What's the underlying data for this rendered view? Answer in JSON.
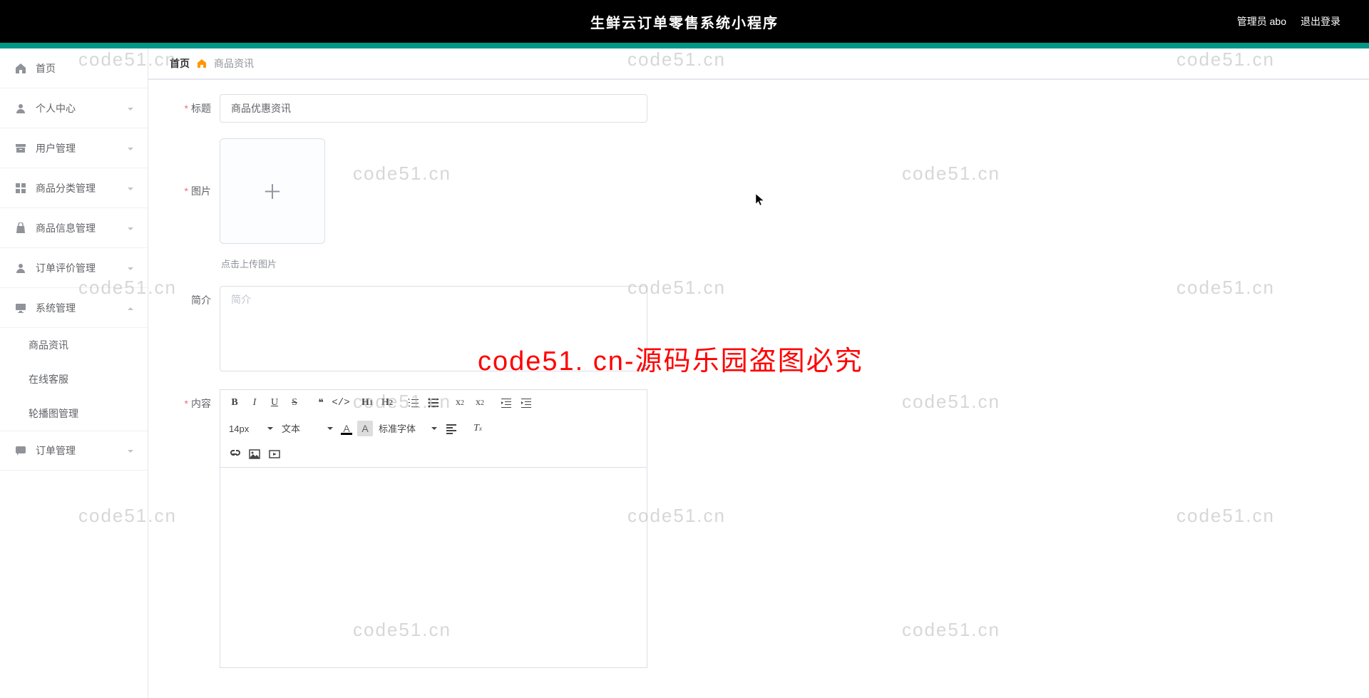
{
  "header": {
    "title": "生鲜云订单零售系统小程序",
    "admin_label": "管理员 abo",
    "logout_label": "退出登录"
  },
  "sidebar": {
    "items": [
      {
        "key": "home",
        "label": "首页",
        "icon": "home",
        "has_children": false
      },
      {
        "key": "personal",
        "label": "个人中心",
        "icon": "user",
        "has_children": true
      },
      {
        "key": "users",
        "label": "用户管理",
        "icon": "archive",
        "has_children": true
      },
      {
        "key": "category",
        "label": "商品分类管理",
        "icon": "grid",
        "has_children": true
      },
      {
        "key": "product",
        "label": "商品信息管理",
        "icon": "bag",
        "has_children": true
      },
      {
        "key": "review",
        "label": "订单评价管理",
        "icon": "person",
        "has_children": true
      },
      {
        "key": "system",
        "label": "系统管理",
        "icon": "monitor",
        "has_children": true,
        "expanded": true,
        "children": [
          {
            "key": "news",
            "label": "商品资讯"
          },
          {
            "key": "service",
            "label": "在线客服"
          },
          {
            "key": "carousel",
            "label": "轮播图管理"
          }
        ]
      },
      {
        "key": "order",
        "label": "订单管理",
        "icon": "chat",
        "has_children": true
      }
    ]
  },
  "breadcrumb": {
    "home": "首页",
    "current": "商品资讯"
  },
  "form": {
    "title_label": "标题",
    "title_value": "商品优惠资讯",
    "image_label": "图片",
    "upload_tip": "点击上传图片",
    "intro_label": "简介",
    "intro_placeholder": "简介",
    "content_label": "内容"
  },
  "editor": {
    "font_size": "14px",
    "format": "文本",
    "font_family": "标准字体"
  },
  "watermark": {
    "text": "code51.cn",
    "center": "code51. cn-源码乐园盗图必究"
  }
}
